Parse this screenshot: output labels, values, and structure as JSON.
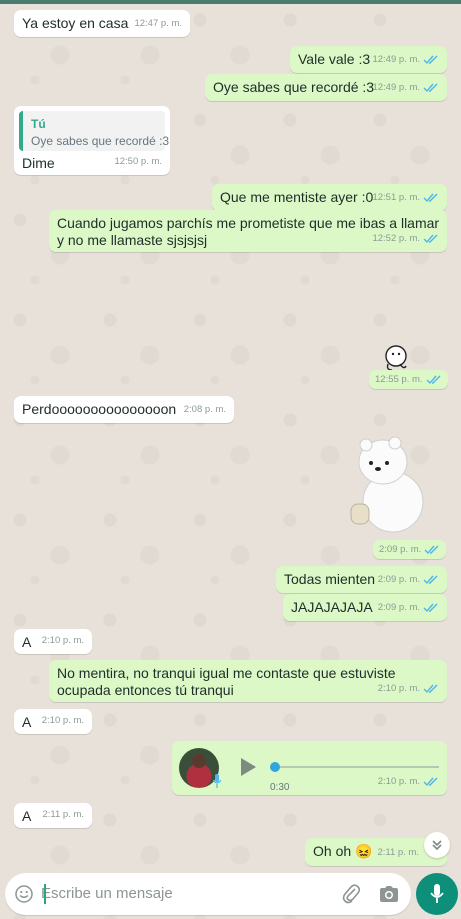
{
  "messages": [
    {
      "text": "Ya estoy en casa",
      "time": "12:47 p. m."
    },
    {
      "text": "Vale vale :3",
      "time": "12:49 p. m."
    },
    {
      "text": "Oye sabes que recordé :3",
      "time": "12:49 p. m."
    },
    {
      "quote_author": "Tú",
      "quote_text": "Oye sabes que recordé :3",
      "text": "Dime",
      "time": "12:50 p. m."
    },
    {
      "text": "Que me mentiste ayer :0",
      "time": "12:51 p. m."
    },
    {
      "text_line1": "Cuando jugamos parchís me prometiste que me ibas a llamar",
      "text_line2": "y no me llamaste sjsjsjsj",
      "time": "12:52 p. m."
    },
    {
      "time": "12:55 p. m."
    },
    {
      "text": "Perdooooooooooooooon",
      "time": "2:08 p. m."
    },
    {
      "time": "2:09 p. m."
    },
    {
      "text": "Todas mienten",
      "time": "2:09 p. m."
    },
    {
      "text": "JAJAJAJAJA",
      "time": "2:09 p. m."
    },
    {
      "text": "A",
      "time": "2:10 p. m."
    },
    {
      "text_line1": "No mentira, no tranqui igual me contaste que estuviste",
      "text_line2": "ocupada entonces tú tranqui",
      "time": "2:10 p. m."
    },
    {
      "text": "A",
      "time": "2:10 p. m."
    },
    {
      "duration": "0:30",
      "time": "2:10 p. m.",
      "progress": 0
    },
    {
      "text": "A",
      "time": "2:11 p. m."
    },
    {
      "text": "Oh oh",
      "emoji": "😖",
      "time": "2:11 p. m."
    }
  ],
  "composer": {
    "placeholder": "Escribe un mensaje"
  },
  "icons": {
    "emoji": "emoji-icon",
    "attach": "paperclip-icon",
    "camera": "camera-icon",
    "mic": "microphone-icon",
    "scroll": "chevron-down-icon",
    "play": "play-icon"
  },
  "colors": {
    "incoming": "#ffffff",
    "outgoing": "#dcf8c6",
    "read_ticks": "#4fb6ec",
    "accent": "#0d8f7a"
  }
}
